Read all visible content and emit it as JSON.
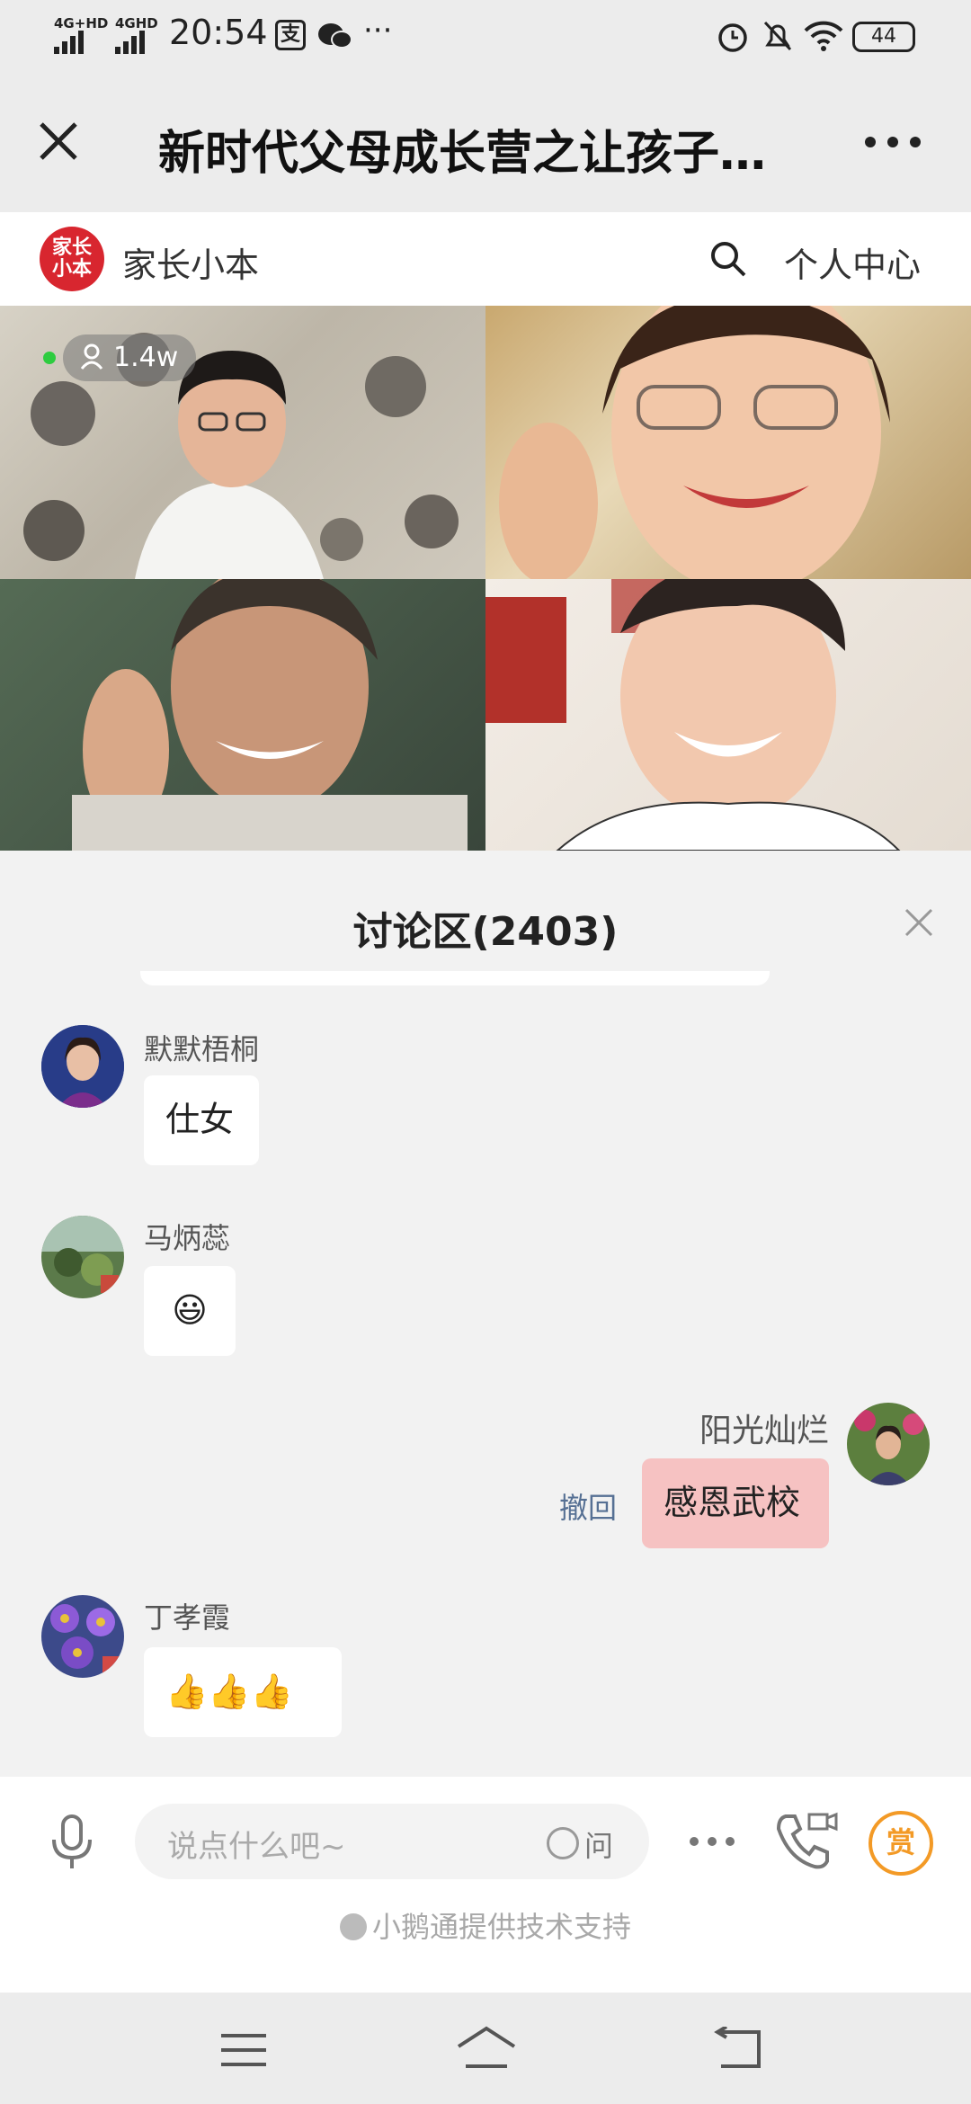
{
  "status_bar": {
    "network1": "4G+HD",
    "network2": "4GHD",
    "time": "20:54",
    "battery": "44"
  },
  "title_bar": {
    "title": "新时代父母成长营之让孩子…"
  },
  "app_header": {
    "logo_text": "家长小本",
    "brand": "家长小本",
    "user_center": "个人中心"
  },
  "live": {
    "viewers": "1.4w"
  },
  "discussion": {
    "title": "讨论区(2403)",
    "messages": [
      {
        "user": "默默梧桐",
        "text": "仕女",
        "mine": false
      },
      {
        "user": "马炳蕊",
        "text": "😃",
        "mine": false
      },
      {
        "user": "阳光灿烂",
        "text": "感恩武校",
        "mine": true,
        "recall": "撤回"
      },
      {
        "user": "丁孝霞",
        "text": "👍👍👍",
        "mine": false
      }
    ]
  },
  "input_bar": {
    "placeholder": "说点什么吧~",
    "ask_label": "问",
    "reward_label": "赏",
    "support_text": "小鹅通提供技术支持"
  },
  "colors": {
    "accent_orange": "#f39a26",
    "logo_red": "#d8262f",
    "my_bubble": "#f6c2c2",
    "recall_link": "#567094"
  }
}
